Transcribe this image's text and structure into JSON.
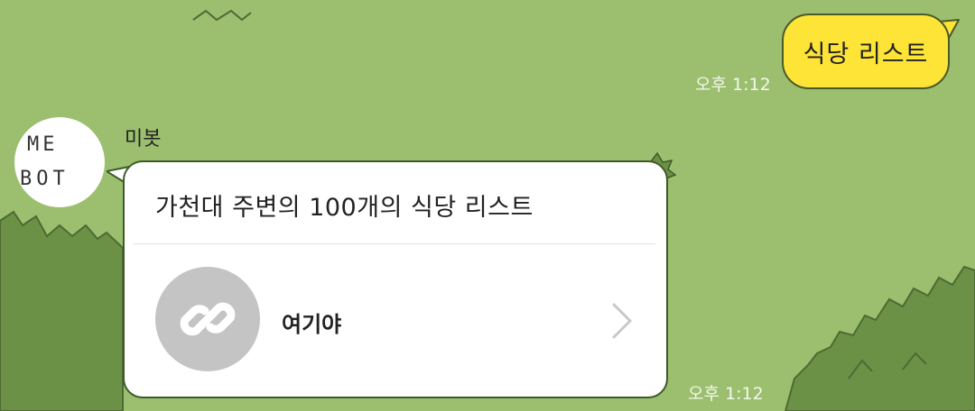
{
  "chat": {
    "outgoing": {
      "text": "식당 리스트",
      "time": "오후 1:12"
    },
    "incoming": {
      "sender": "미봇",
      "avatar_text_line1": "ME",
      "avatar_text_line2": "BOT",
      "card_title": "가천대 주변의 100개의 식당 리스트",
      "link_label": "여기야",
      "link_icon": "link-icon",
      "time": "오후 1:12"
    }
  },
  "colors": {
    "background": "#9bbf6f",
    "bush": "#6b9146",
    "outgoing_bubble": "#fee437",
    "card": "#ffffff"
  }
}
